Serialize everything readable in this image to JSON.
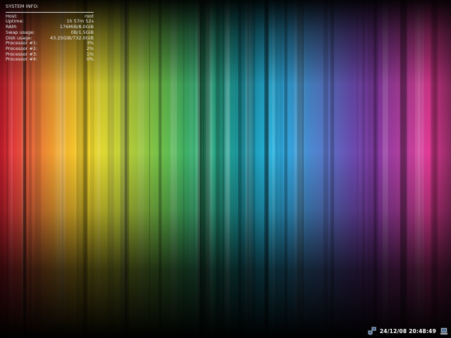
{
  "sysinfo": {
    "title": "SYSTEM INFO:",
    "rows": [
      {
        "label": "Host:",
        "value": "root"
      },
      {
        "label": "Uptime:",
        "value": "1h 57m 52s"
      },
      {
        "label": "RAM:",
        "value": "176MiB/8.0GiB"
      },
      {
        "label": "Swap usage:",
        "value": "0B/1.5GiB"
      },
      {
        "label": "Disk usage:",
        "value": "43.25GiB/732.0GiB"
      },
      {
        "label": "Processor #1:",
        "value": "3%"
      },
      {
        "label": "Processor #2:",
        "value": "2%"
      },
      {
        "label": "Processor #3:",
        "value": "1%"
      },
      {
        "label": "Processor #4:",
        "value": "0%"
      }
    ]
  },
  "tray": {
    "clock": "24/12/08 20:48:49",
    "icons": [
      "network-icon",
      "laptop-icon"
    ]
  },
  "colors": {
    "text": "#e8e8e8",
    "background": "#000000"
  }
}
